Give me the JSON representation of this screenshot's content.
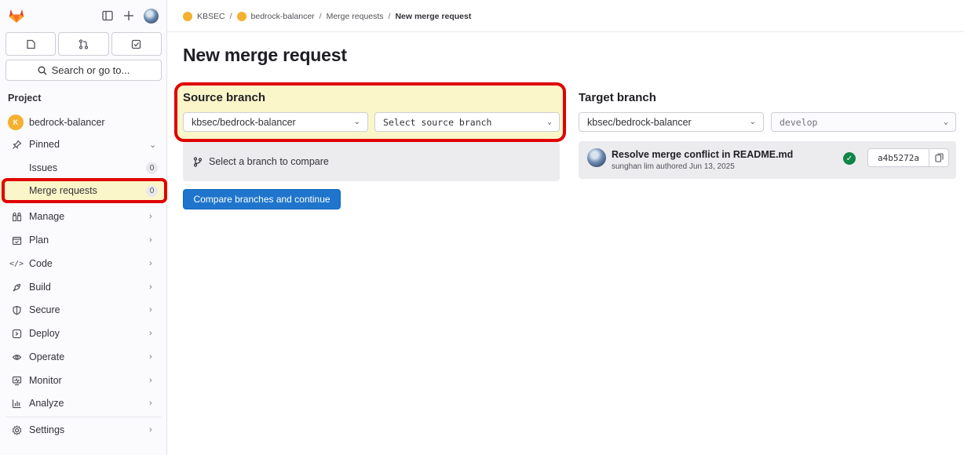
{
  "sidebar": {
    "search_label": "Search or go to...",
    "section_label": "Project",
    "project_name": "bedrock-balancer",
    "project_avatar_text": "K",
    "pinned_label": "Pinned",
    "pinned_items": [
      {
        "label": "Issues",
        "count": "0"
      },
      {
        "label": "Merge requests",
        "count": "0"
      }
    ],
    "nav": [
      {
        "label": "Manage",
        "icon": "manage-icon"
      },
      {
        "label": "Plan",
        "icon": "plan-icon"
      },
      {
        "label": "Code",
        "icon": "code-icon"
      },
      {
        "label": "Build",
        "icon": "build-icon"
      },
      {
        "label": "Secure",
        "icon": "shield-icon"
      },
      {
        "label": "Deploy",
        "icon": "deploy-icon"
      },
      {
        "label": "Operate",
        "icon": "operate-icon"
      },
      {
        "label": "Monitor",
        "icon": "monitor-icon"
      },
      {
        "label": "Analyze",
        "icon": "analyze-icon"
      }
    ],
    "settings_label": "Settings"
  },
  "breadcrumb": {
    "group": "KBSEC",
    "project": "bedrock-balancer",
    "section": "Merge requests",
    "current": "New merge request"
  },
  "page": {
    "title": "New merge request"
  },
  "source": {
    "title": "Source branch",
    "project_select": "kbsec/bedrock-balancer",
    "branch_placeholder": "Select source branch",
    "compare_hint": "Select a branch to compare",
    "compare_button": "Compare branches and continue"
  },
  "target": {
    "title": "Target branch",
    "project_select": "kbsec/bedrock-balancer",
    "branch_select": "develop",
    "commit": {
      "title": "Resolve merge conflict in README.md",
      "author": "sunghan lim",
      "authored_text": "authored Jun 13, 2025",
      "sha": "a4b5272a",
      "status": "success"
    }
  },
  "colors": {
    "highlight": "#e00000",
    "accent": "#1f75cb",
    "highlight_fill": "#fbf6c9",
    "success": "#108548"
  }
}
